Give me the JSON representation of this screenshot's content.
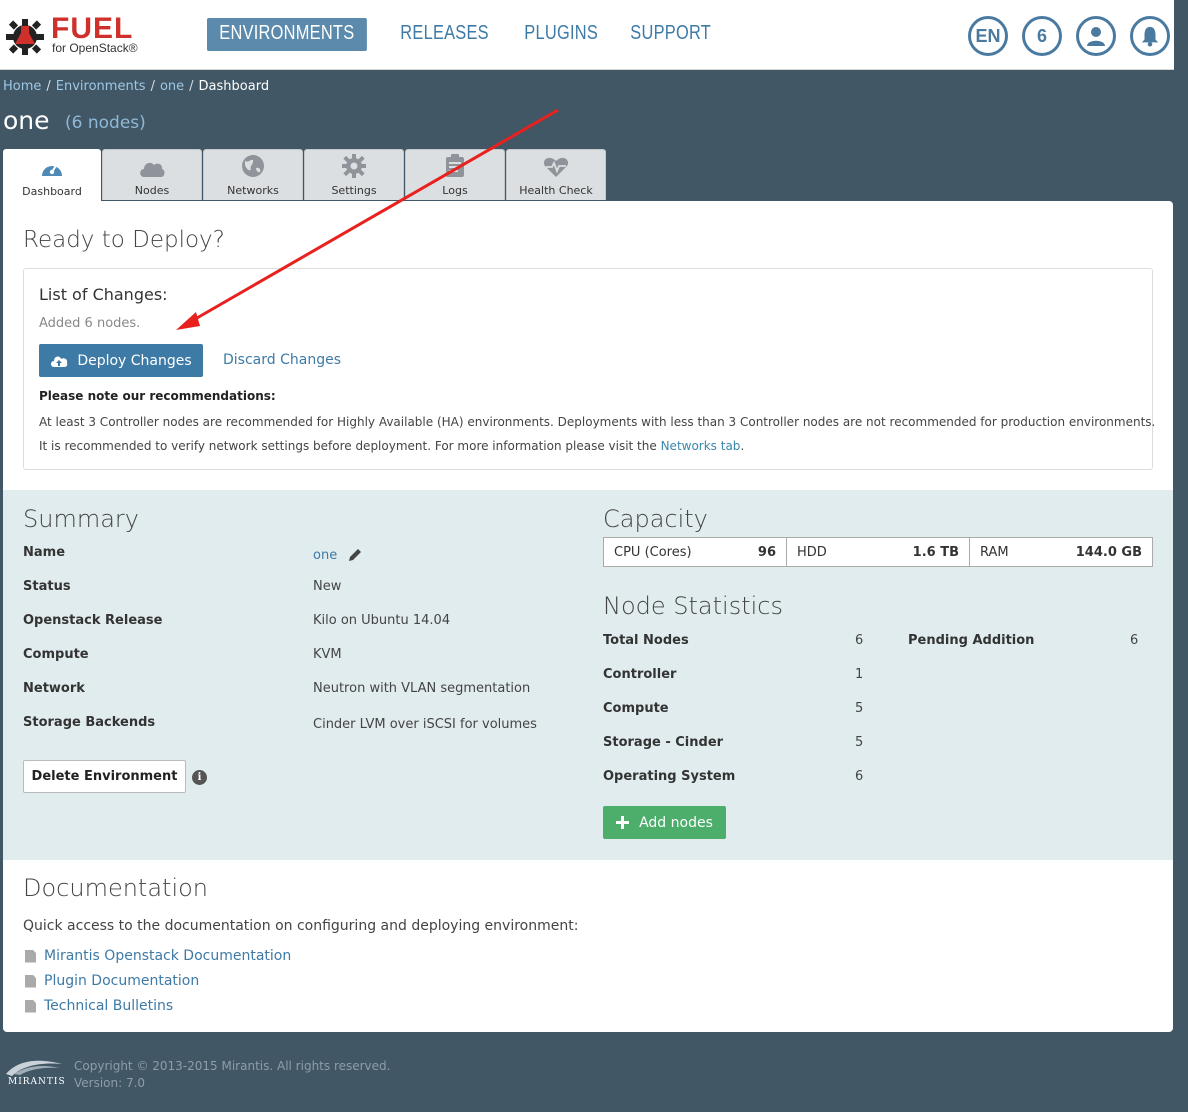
{
  "brand": {
    "name": "FUEL",
    "subtitle": "for OpenStack®"
  },
  "nav": {
    "tabs": [
      {
        "label": "ENVIRONMENTS",
        "active": true
      },
      {
        "label": "RELEASES",
        "active": false
      },
      {
        "label": "PLUGINS",
        "active": false
      },
      {
        "label": "SUPPORT",
        "active": false
      }
    ],
    "language": "EN",
    "notifications_count": "6",
    "user_icon": "user-icon",
    "bell_icon": "bell-icon"
  },
  "breadcrumb": {
    "items": [
      "Home",
      "Environments",
      "one",
      "Dashboard"
    ],
    "separator": "/"
  },
  "environment": {
    "name": "one",
    "node_count": "(6 nodes)"
  },
  "tabs": [
    {
      "label": "Dashboard",
      "icon": "dashboard-icon",
      "active": true
    },
    {
      "label": "Nodes",
      "icon": "cloud-icon",
      "active": false
    },
    {
      "label": "Networks",
      "icon": "globe-icon",
      "active": false
    },
    {
      "label": "Settings",
      "icon": "gear-icon",
      "active": false
    },
    {
      "label": "Logs",
      "icon": "clipboard-icon",
      "active": false
    },
    {
      "label": "Health Check",
      "icon": "heartbeat-icon",
      "active": false
    }
  ],
  "deploy": {
    "title": "Ready to Deploy?",
    "changes_title": "List of Changes:",
    "changes_text": "Added 6 nodes.",
    "deploy_button": "Deploy Changes",
    "discard_link": "Discard Changes",
    "recommendations_title": "Please note our recommendations:",
    "recommendation_1": "At least 3 Controller nodes are recommended for Highly Available (HA) environments. Deployments with less than 3 Controller nodes are not recommended for production environments.",
    "recommendation_2_prefix": "It is recommended to verify network settings before deployment. For more information please visit the ",
    "recommendation_2_link": "Networks tab",
    "recommendation_2_suffix": "."
  },
  "summary": {
    "title": "Summary",
    "rows": [
      {
        "label": "Name",
        "value": "one"
      },
      {
        "label": "Status",
        "value": "New"
      },
      {
        "label": "Openstack Release",
        "value": "Kilo on Ubuntu 14.04"
      },
      {
        "label": "Compute",
        "value": "KVM"
      },
      {
        "label": "Network",
        "value": "Neutron with VLAN segmentation"
      },
      {
        "label": "Storage Backends",
        "value": "Cinder LVM over iSCSI for volumes"
      }
    ],
    "delete_button": "Delete Environment"
  },
  "capacity": {
    "title": "Capacity",
    "items": [
      {
        "label": "CPU (Cores)",
        "value": "96"
      },
      {
        "label": "HDD",
        "value": "1.6 TB"
      },
      {
        "label": "RAM",
        "value": "144.0 GB"
      }
    ]
  },
  "node_statistics": {
    "title": "Node Statistics",
    "rows": [
      {
        "label": "Total Nodes",
        "value": "6"
      },
      {
        "label": "Controller",
        "value": "1"
      },
      {
        "label": "Compute",
        "value": "5"
      },
      {
        "label": "Storage - Cinder",
        "value": "5"
      },
      {
        "label": "Operating System",
        "value": "6"
      }
    ],
    "pending_label": "Pending Addition",
    "pending_value": "6",
    "add_button": "Add nodes"
  },
  "documentation": {
    "title": "Documentation",
    "description": "Quick access to the documentation on configuring and deploying environment:",
    "links": [
      "Mirantis Openstack Documentation",
      "Plugin Documentation",
      "Technical Bulletins"
    ]
  },
  "footer": {
    "brand": "MIRANTIS",
    "copyright": "Copyright © 2013-2015 Mirantis. All rights reserved.",
    "version": "Version: 7.0"
  },
  "colors": {
    "background": "#415766",
    "primary": "#3d7aa6",
    "success": "#4cae6a",
    "brand_red": "#d0302b",
    "annotation_arrow": "#e8211f"
  }
}
